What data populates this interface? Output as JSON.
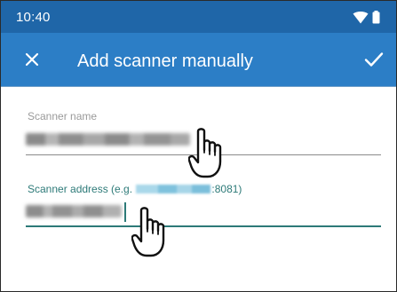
{
  "status_bar": {
    "time": "10:40",
    "icons": [
      "wifi-icon",
      "battery-icon"
    ]
  },
  "app_bar": {
    "title": "Add scanner manually",
    "close_icon": "close-icon",
    "confirm_icon": "check-icon"
  },
  "form": {
    "scanner_name": {
      "label": "Scanner name",
      "value_obscured": true
    },
    "scanner_address": {
      "label_prefix": "Scanner address (e.g. ",
      "label_suffix": ":8081)",
      "value_obscured": true,
      "focused": true
    }
  },
  "overlays": {
    "gesture_icon": "tap-hand-icon"
  },
  "colors": {
    "status_bar": "#1f66a8",
    "app_bar": "#2c7ec6",
    "accent": "#2d7a78",
    "label": "#9a9a9a"
  }
}
